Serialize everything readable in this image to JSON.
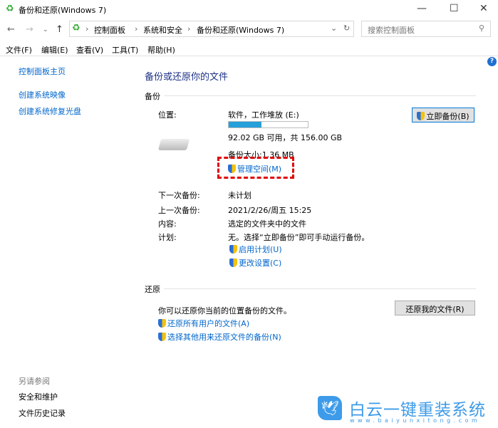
{
  "window": {
    "title": "备份和还原(Windows 7)"
  },
  "address": {
    "crumbs": [
      "控制面板",
      "系统和安全",
      "备份和还原(Windows 7)"
    ],
    "search_placeholder": "搜索控制面板"
  },
  "menu": [
    "文件(F)",
    "编辑(E)",
    "查看(V)",
    "工具(T)",
    "帮助(H)"
  ],
  "sidebar": {
    "items": [
      "控制面板主页",
      "创建系统映像",
      "创建系统修复光盘"
    ],
    "see_also_title": "另请参阅",
    "see_also": [
      "安全和维护",
      "文件历史记录"
    ]
  },
  "main": {
    "heading": "备份或还原你的文件",
    "backup": {
      "section": "备份",
      "location_label": "位置:",
      "location_value": "软件，工作堆放 (E:)",
      "usage_fraction": 0.41,
      "free_text": "92.02 GB 可用，共 156.00 GB",
      "size_text": "备份大小:1.36 MB",
      "manage_space": "管理空间(M)",
      "backup_now": "立即备份(B)",
      "rows": [
        {
          "label": "下一次备份:",
          "value": "未计划"
        },
        {
          "label": "上一次备份:",
          "value": "2021/2/26/周五 15:25"
        },
        {
          "label": "内容:",
          "value": "选定的文件夹中的文件"
        },
        {
          "label": "计划:",
          "value": "无。选择“立即备份”即可手动运行备份。"
        }
      ],
      "enable_schedule": "启用计划(U)",
      "change_settings": "更改设置(C)"
    },
    "restore": {
      "section": "还原",
      "text": "你可以还原你当前的位置备份的文件。",
      "restore_button": "还原我的文件(R)",
      "link1": "还原所有用户的文件(A)",
      "link2": "选择其他用来还原文件的备份(N)"
    }
  },
  "watermark": {
    "brand": "白云一键重装系统",
    "url": "www.baiyunxitong.com"
  },
  "colors": {
    "accent": "#0066cc",
    "progress": "#26a0da",
    "highlight": "#e00000"
  }
}
